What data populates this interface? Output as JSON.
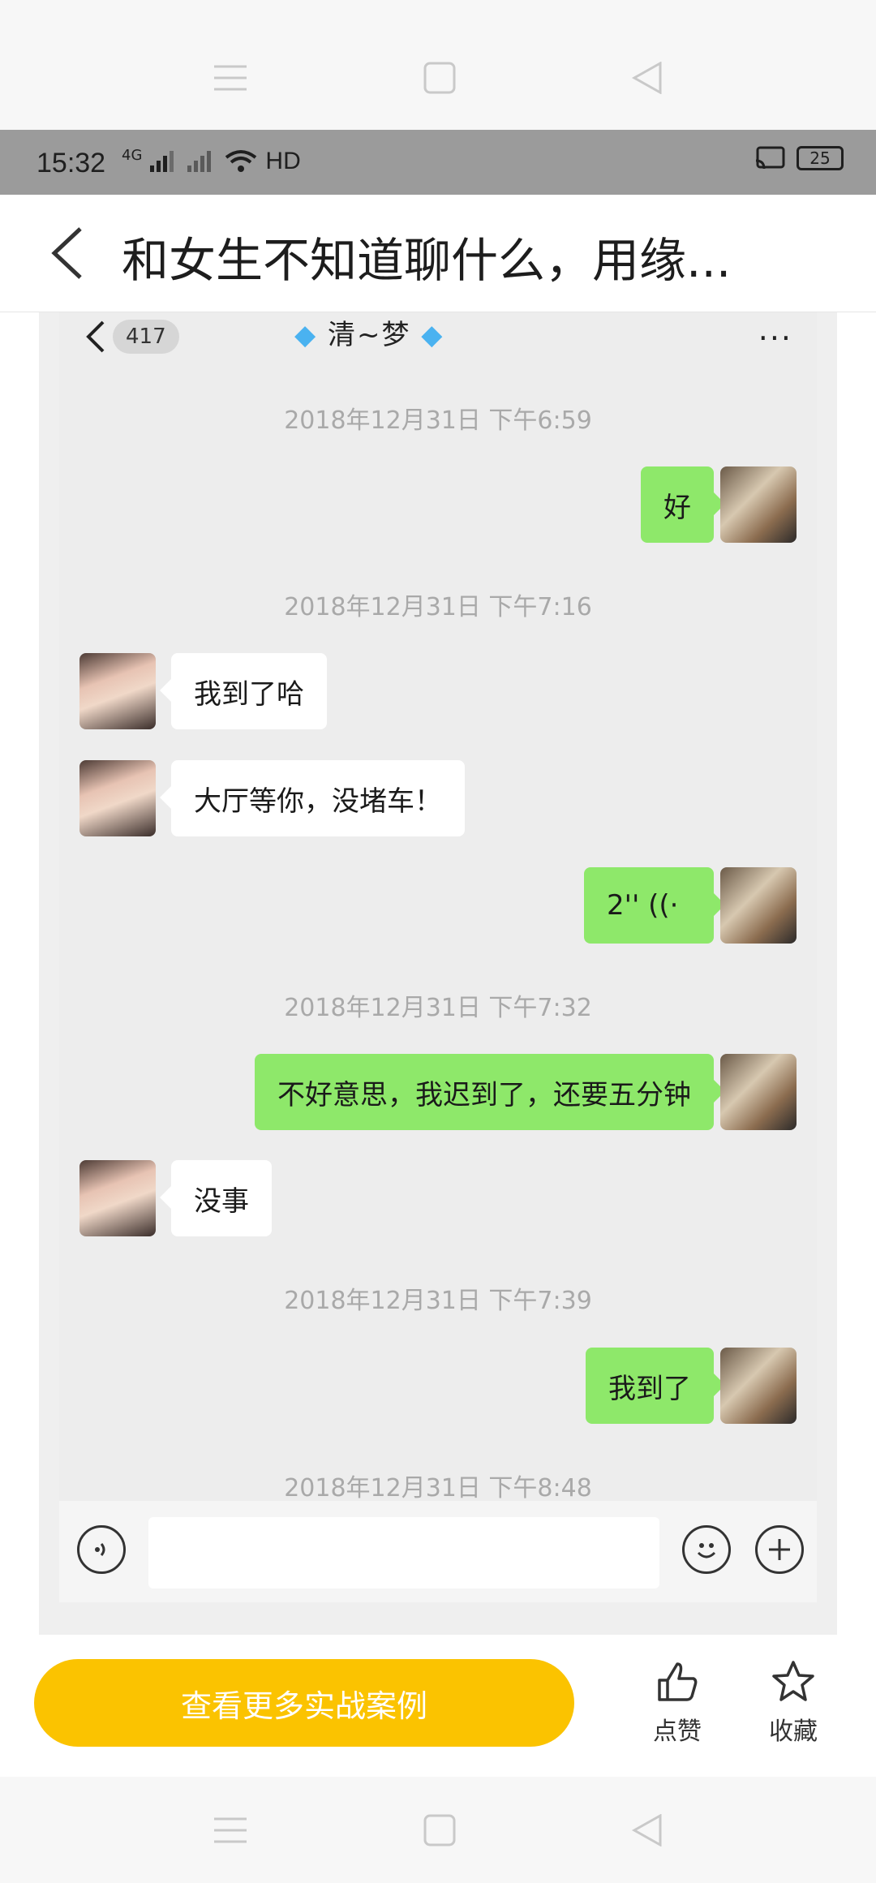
{
  "status_bar": {
    "time": "15:32",
    "network": "4G",
    "hd": "HD",
    "battery": "25"
  },
  "header": {
    "title": "和女生不知道聊什么，用缘..."
  },
  "chat": {
    "unread_badge": "417",
    "contact_name": "清~梦",
    "more": "···",
    "timestamps": [
      "2018年12月31日 下午6:59",
      "2018年12月31日 下午7:16",
      "2018年12月31日 下午7:32",
      "2018年12月31日 下午7:39",
      "2018年12月31日 下午8:48"
    ],
    "messages": [
      {
        "from": "me",
        "text": "好"
      },
      {
        "from": "her",
        "text": "我到了哈"
      },
      {
        "from": "her",
        "text": "大厅等你，没堵车！"
      },
      {
        "from": "me",
        "text": "2'' ((·"
      },
      {
        "from": "me",
        "text": "不好意思，我迟到了，还要五分钟"
      },
      {
        "from": "her",
        "text": "没事"
      },
      {
        "from": "me",
        "text": "我到了"
      }
    ]
  },
  "actions": {
    "cta": "查看更多实战案例",
    "like": "点赞",
    "favorite": "收藏"
  }
}
